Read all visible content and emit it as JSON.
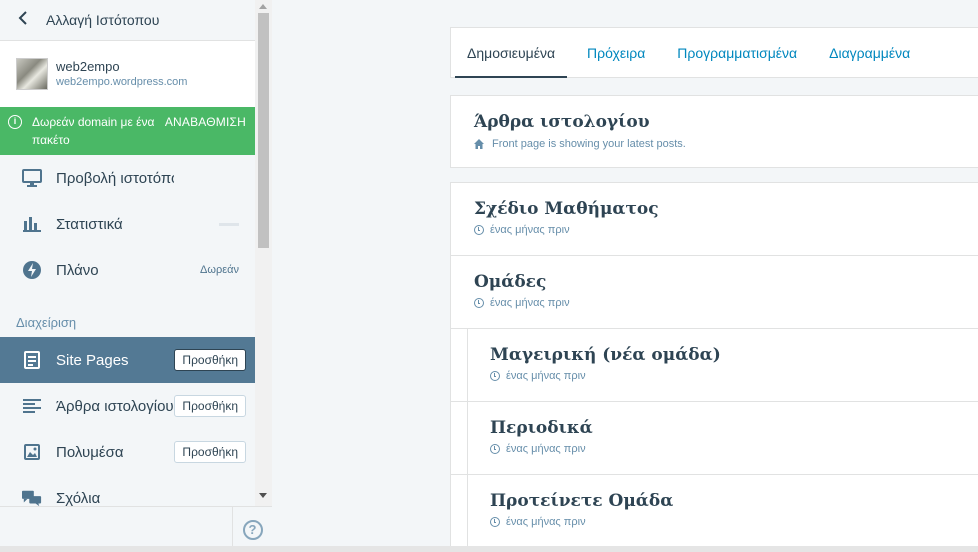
{
  "sidebar": {
    "switch_site_label": "Αλλαγή Ιστότοπου",
    "site": {
      "title": "web2empo",
      "url": "web2empo.wordpress.com"
    },
    "upsell": {
      "message": "Δωρεάν domain με ένα πακέτο",
      "cta": "ΑΝΑΒΑΘΜΙΣΗ"
    },
    "items": [
      {
        "label": "Προβολή ιστοτόπου",
        "icon": "monitor-icon"
      },
      {
        "label": "Στατιστικά",
        "icon": "bar-chart-icon"
      },
      {
        "label": "Πλάνο",
        "icon": "plan-icon",
        "badge": "Δωρεάν"
      }
    ],
    "manage_heading": "Διαχείριση",
    "manage_items": [
      {
        "label": "Site Pages",
        "icon": "page-icon",
        "add_label": "Προσθήκη"
      },
      {
        "label": "Άρθρα ιστολογίου",
        "icon": "posts-icon",
        "add_label": "Προσθήκη"
      },
      {
        "label": "Πολυμέσα",
        "icon": "image-icon",
        "add_label": "Προσθήκη"
      },
      {
        "label": "Σχόλια",
        "icon": "comments-icon"
      }
    ],
    "help_label": "?"
  },
  "main": {
    "tabs": [
      {
        "label": "Δημοσιευμένα"
      },
      {
        "label": "Πρόχειρα"
      },
      {
        "label": "Προγραμματισμένα"
      },
      {
        "label": "Διαγραμμένα"
      }
    ],
    "blog_card": {
      "title": "Άρθρα ιστολογίου",
      "subtitle": "Front page is showing your latest posts."
    },
    "pages": [
      {
        "title": "Σχέδιο Μαθήματος",
        "meta": "ένας μήνας πριν"
      },
      {
        "title": "Ομάδες",
        "meta": "ένας μήνας πριν"
      },
      {
        "title": "Μαγειρική (νέα ομάδα)",
        "meta": "ένας μήνας πριν"
      },
      {
        "title": "Περιοδικά",
        "meta": "ένας μήνας πριν"
      },
      {
        "title": "Προτείνετε Ομάδα",
        "meta": "ένας μήνας πριν"
      }
    ]
  },
  "colors": {
    "accent": "#0087be",
    "selected": "#537994",
    "upsell": "#4ab866"
  }
}
